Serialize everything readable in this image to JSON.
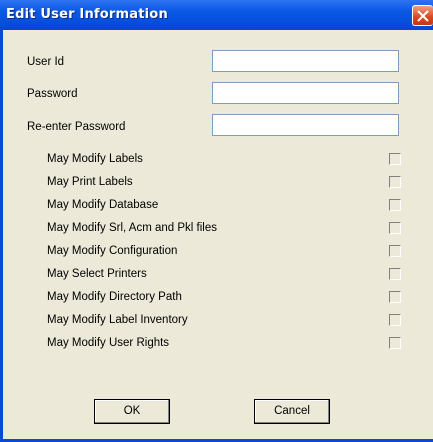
{
  "window": {
    "title": "Edit User Information"
  },
  "fields": [
    {
      "label": "User Id",
      "value": ""
    },
    {
      "label": "Password",
      "value": ""
    },
    {
      "label": "Re-enter Password",
      "value": ""
    }
  ],
  "permissions": [
    {
      "label": "May Modify Labels",
      "checked": false
    },
    {
      "label": "May Print Labels",
      "checked": false
    },
    {
      "label": "May Modify Database",
      "checked": false
    },
    {
      "label": "May Modify Srl, Acm and Pkl files",
      "checked": false
    },
    {
      "label": "May Modify Configuration",
      "checked": false
    },
    {
      "label": "May Select Printers",
      "checked": false
    },
    {
      "label": "May Modify Directory Path",
      "checked": false
    },
    {
      "label": "May Modify Label Inventory",
      "checked": false
    },
    {
      "label": "May Modify User Rights",
      "checked": false
    }
  ],
  "buttons": {
    "ok": "OK",
    "cancel": "Cancel"
  },
  "colors": {
    "titlebar": "#0446d6",
    "client": "#ece9d8",
    "close": "#d9461e"
  }
}
